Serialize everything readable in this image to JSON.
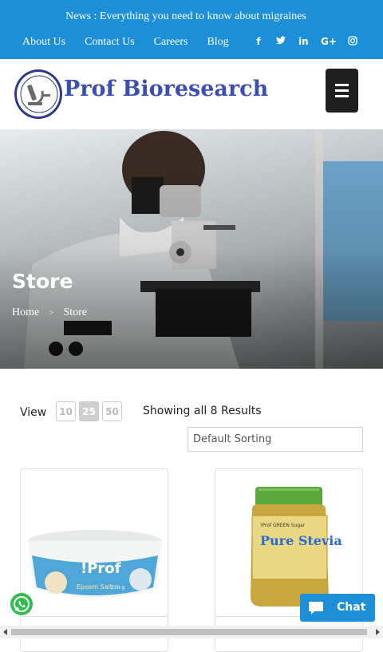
{
  "topbar": {
    "news": "News : Everything you need to know about migraines",
    "links": [
      "About Us",
      "Contact Us",
      "Careers",
      "Blog"
    ],
    "social": [
      {
        "name": "facebook-icon",
        "glyph": "f"
      },
      {
        "name": "twitter-icon",
        "glyph": "t"
      },
      {
        "name": "linkedin-icon",
        "glyph": "in"
      },
      {
        "name": "google-plus-icon",
        "glyph": "G+"
      },
      {
        "name": "instagram-icon",
        "glyph": "◎"
      }
    ],
    "color": "#1c8fd8"
  },
  "header": {
    "brand": "Prof Bioresearch",
    "menu_icon": "hamburger-menu-icon"
  },
  "hero": {
    "title": "Store",
    "breadcrumb": {
      "home": "Home",
      "separator": ">",
      "current": "Store"
    }
  },
  "shop": {
    "view_label": "View",
    "page_sizes": [
      "10",
      "25",
      "50"
    ],
    "selected_page_size": "25",
    "results_text": "Showing all 8 Results",
    "sorting": "Default Sorting"
  },
  "products": [
    {
      "label": "!Prof",
      "sublabel": "Epsom Salt",
      "weight": "250 g"
    },
    {
      "label": "!Prof GREEN Sugar",
      "sublabel": "Pure Stevia"
    }
  ],
  "widgets": {
    "chat_label": "Chat",
    "whatsapp_icon": "whatsapp-icon",
    "chat_icon": "chat-bubble-icon"
  }
}
